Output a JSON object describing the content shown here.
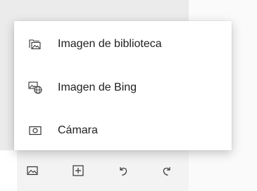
{
  "menu": {
    "items": [
      {
        "label": "Imagen de biblioteca",
        "icon": "library-image-icon"
      },
      {
        "label": "Imagen de Bing",
        "icon": "bing-image-icon"
      },
      {
        "label": "Cámara",
        "icon": "camera-icon"
      }
    ]
  },
  "toolbar": {
    "buttons": [
      {
        "icon": "image-icon"
      },
      {
        "icon": "add-icon"
      },
      {
        "icon": "undo-icon"
      },
      {
        "icon": "redo-icon"
      }
    ]
  },
  "colors": {
    "backdrop": "#ebebeb",
    "toolbar": "#f3f3f3",
    "menu_background": "#ffffff",
    "text": "#1f1f1f",
    "icon": "#333333"
  }
}
